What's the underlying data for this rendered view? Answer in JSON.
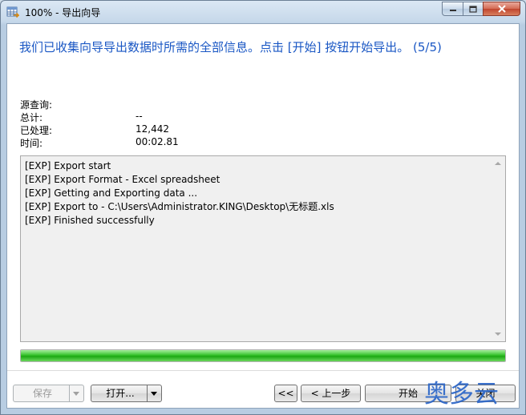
{
  "window": {
    "title": "100% - 导出向导"
  },
  "headline": "我们已收集向导导出数据时所需的全部信息。点击 [开始] 按钮开始导出。 (5/5)",
  "summary": [
    {
      "label": "源查询:",
      "value": ""
    },
    {
      "label": "总计:",
      "value": "--"
    },
    {
      "label": "已处理:",
      "value": "12,442"
    },
    {
      "label": "时间:",
      "value": "00:02.81"
    }
  ],
  "log": [
    "[EXP] Export start",
    "[EXP] Export Format - Excel spreadsheet",
    "[EXP] Getting and Exporting data ...",
    "[EXP] Export to - C:\\Users\\Administrator.KING\\Desktop\\无标题.xls",
    "[EXP] Finished successfully"
  ],
  "progress": {
    "fraction": 1.0,
    "color": "#1ba813"
  },
  "buttons": {
    "save": "保存",
    "open": "打开...",
    "first": "<<",
    "prev": "< 上一步",
    "start": "开始",
    "close": "关闭"
  },
  "watermark": "奥多云",
  "colors": {
    "headline": "#1a57c4",
    "watermark": "#2b66c8"
  }
}
